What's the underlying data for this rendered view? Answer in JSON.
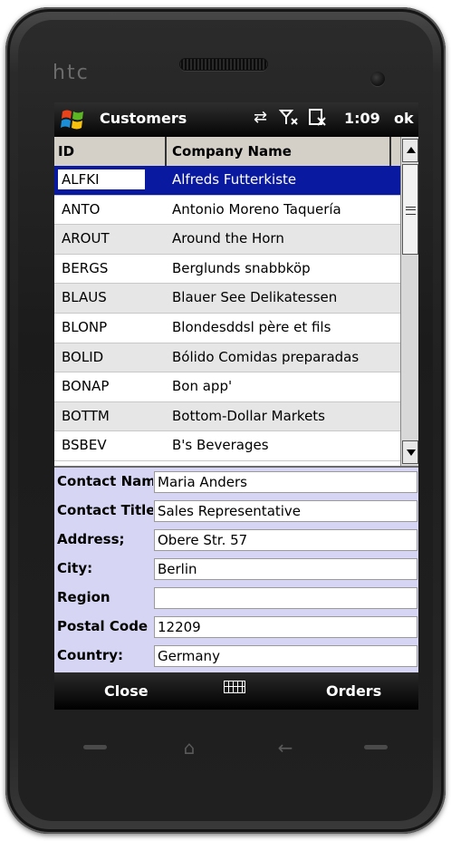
{
  "device": {
    "brand": "htc"
  },
  "titlebar": {
    "app_title": "Customers",
    "clock": "1:09",
    "ok_label": "ok",
    "icons": [
      "windows-start-icon",
      "connectivity-arrows-icon",
      "signal-off-icon",
      "sound-off-icon"
    ]
  },
  "grid": {
    "columns": [
      "ID",
      "Company Name"
    ],
    "rows": [
      {
        "id": "ALFKI",
        "name": "Alfreds Futterkiste",
        "selected": true
      },
      {
        "id": "ANTO",
        "name": "Antonio Moreno Taquería"
      },
      {
        "id": "AROUT",
        "name": "Around the Horn"
      },
      {
        "id": "BERGS",
        "name": "Berglunds snabbköp"
      },
      {
        "id": "BLAUS",
        "name": "Blauer See Delikatessen"
      },
      {
        "id": "BLONP",
        "name": "Blondesddsl père et fils"
      },
      {
        "id": "BOLID",
        "name": "Bólido Comidas preparadas"
      },
      {
        "id": "BONAP",
        "name": "Bon app'"
      },
      {
        "id": "BOTTM",
        "name": "Bottom-Dollar Markets"
      },
      {
        "id": "BSBEV",
        "name": "B's Beverages"
      }
    ]
  },
  "details": [
    {
      "label": "Contact Nam",
      "value": "Maria Anders"
    },
    {
      "label": "Contact Title",
      "value": "Sales Representative"
    },
    {
      "label": "Address;",
      "value": "Obere Str. 57"
    },
    {
      "label": "City:",
      "value": "Berlin"
    },
    {
      "label": "Region",
      "value": ""
    },
    {
      "label": "Postal Code",
      "value": "12209"
    },
    {
      "label": "Country:",
      "value": "Germany"
    }
  ],
  "softkeys": {
    "left": "Close",
    "right": "Orders"
  },
  "colors": {
    "selection": "#0a1aa0",
    "form_bg": "#d6d6f4",
    "row_alt": "#e6e6e6"
  }
}
